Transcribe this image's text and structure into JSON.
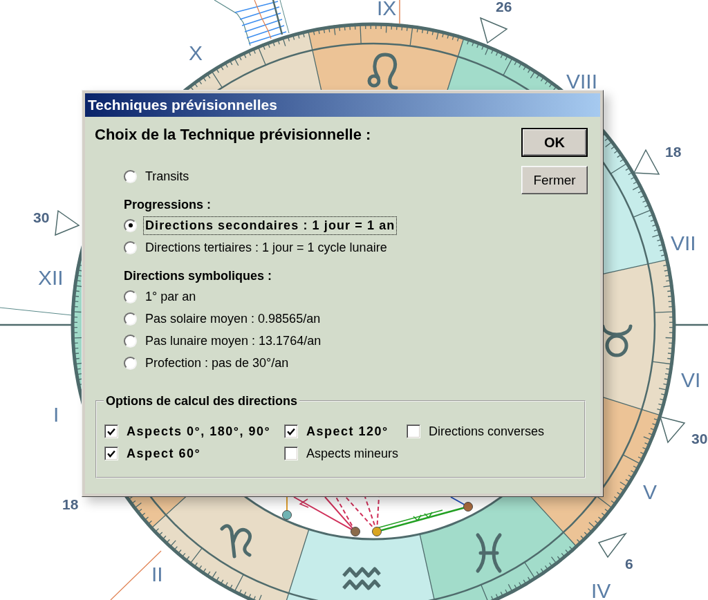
{
  "window": {
    "title": "Techniques prévisionnelles"
  },
  "dialog": {
    "heading": "Choix de la Technique prévisionnelle :",
    "buttons": [
      {
        "label": "OK",
        "default": true
      },
      {
        "label": "Fermer",
        "default": false
      }
    ],
    "technique_groups": [
      {
        "options": [
          {
            "label": "Transits",
            "selected": false,
            "focused": false
          }
        ]
      },
      {
        "heading": "Progressions :",
        "options": [
          {
            "label": "Directions secondaires : 1 jour = 1 an",
            "selected": true,
            "focused": true
          },
          {
            "label": "Directions tertiaires : 1 jour = 1 cycle lunaire",
            "selected": false,
            "focused": false
          }
        ]
      },
      {
        "heading": "Directions symboliques :",
        "options": [
          {
            "label": "1° par an",
            "selected": false,
            "focused": false
          },
          {
            "label": "Pas solaire moyen : 0.98565/an",
            "selected": false,
            "focused": false
          },
          {
            "label": "Pas lunaire moyen : 13.1764/an",
            "selected": false,
            "focused": false
          },
          {
            "label": "Profection : pas de 30°/an",
            "selected": false,
            "focused": false
          }
        ]
      }
    ],
    "calc_options": {
      "title": "Options de calcul des directions",
      "checkboxes": [
        {
          "label": "Aspects 0°, 180°, 90°",
          "checked": true
        },
        {
          "label": "Aspect 120°",
          "checked": true
        },
        {
          "label": "Directions converses",
          "checked": false
        },
        {
          "label": "Aspect 60°",
          "checked": true
        },
        {
          "label": "Aspects mineurs",
          "checked": false
        }
      ]
    }
  },
  "chart": {
    "house_numbers": [
      "IX",
      "X",
      "VIII",
      "VII",
      "XII",
      "VI",
      "I",
      "V",
      "II",
      "IV"
    ],
    "cusp_degrees": [
      "26",
      "18",
      "30",
      "30",
      "18",
      "6"
    ],
    "planets": [
      {
        "color": "#6fb3b3"
      },
      {
        "color": "#8b6b4a"
      },
      {
        "color": "#d9a521"
      },
      {
        "color": "#a86a3e"
      }
    ]
  }
}
